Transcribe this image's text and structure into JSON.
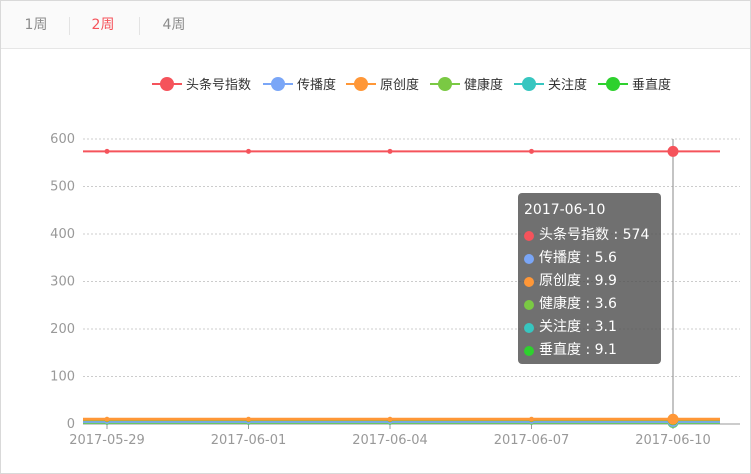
{
  "tabs": [
    {
      "label": "1周",
      "active": false
    },
    {
      "label": "2周",
      "active": true
    },
    {
      "label": "4周",
      "active": false
    }
  ],
  "colors": {
    "accent": "#f5535b",
    "grid": "#cccccc",
    "axis": "#999999",
    "tick_text": "#999999"
  },
  "chart_data": {
    "type": "line",
    "title": "",
    "xlabel": "",
    "ylabel": "",
    "ylim": [
      0,
      600
    ],
    "yticks": [
      0,
      100,
      200,
      300,
      400,
      500,
      600
    ],
    "grid": true,
    "legend": "top-center",
    "x": [
      "2017-05-29",
      "2017-06-01",
      "2017-06-04",
      "2017-06-07",
      "2017-06-10"
    ],
    "series": [
      {
        "name": "头条号指数",
        "color": "#f5535b",
        "values": [
          574,
          574,
          574,
          574,
          574
        ]
      },
      {
        "name": "传播度",
        "color": "#7aa6f7",
        "values": [
          5.6,
          5.6,
          5.6,
          5.6,
          5.6
        ]
      },
      {
        "name": "原创度",
        "color": "#ff9737",
        "values": [
          9.9,
          9.9,
          9.9,
          9.9,
          9.9
        ]
      },
      {
        "name": "健康度",
        "color": "#7ac943",
        "values": [
          3.6,
          3.6,
          3.6,
          3.6,
          3.6
        ]
      },
      {
        "name": "关注度",
        "color": "#37c6c0",
        "values": [
          3.1,
          3.1,
          3.1,
          3.1,
          3.1
        ]
      },
      {
        "name": "垂直度",
        "color": "#2ed12e",
        "values": [
          9.1,
          9.1,
          9.1,
          9.1,
          9.1
        ]
      }
    ],
    "tooltip": {
      "x": "2017-06-10",
      "rows": [
        {
          "name": "头条号指数",
          "value": "574"
        },
        {
          "name": "传播度",
          "value": "5.6"
        },
        {
          "name": "原创度",
          "value": "9.9"
        },
        {
          "name": "健康度",
          "value": "3.6"
        },
        {
          "name": "关注度",
          "value": "3.1"
        },
        {
          "name": "垂直度",
          "value": "9.1"
        }
      ]
    }
  }
}
